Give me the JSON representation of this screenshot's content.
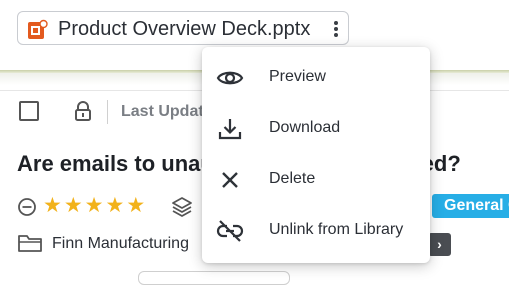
{
  "attachment": {
    "file_name": "Product Overview Deck.pptx",
    "file_icon": "powerpoint-file-icon",
    "more_icon": "kebab-menu-icon"
  },
  "toolbar": {
    "last_updated_label": "Last Updat",
    "lock_icon": "lock-icon"
  },
  "question": {
    "title": "Are emails to unau                              cked?"
  },
  "meta": {
    "rating": 5,
    "rating_max": 5,
    "category_badge": "General C",
    "folder_name": "Finn Manufacturing",
    "nav_chevron": "›"
  },
  "context_menu": {
    "items": [
      {
        "label": "Preview",
        "icon": "eye-icon"
      },
      {
        "label": "Download",
        "icon": "download-icon"
      },
      {
        "label": "Delete",
        "icon": "close-icon"
      },
      {
        "label": "Unlink from Library",
        "icon": "unlink-icon"
      }
    ]
  },
  "colors": {
    "accent_star": "#f2b21b",
    "badge": "#27aee6",
    "powerpoint": "#e35a1f"
  }
}
